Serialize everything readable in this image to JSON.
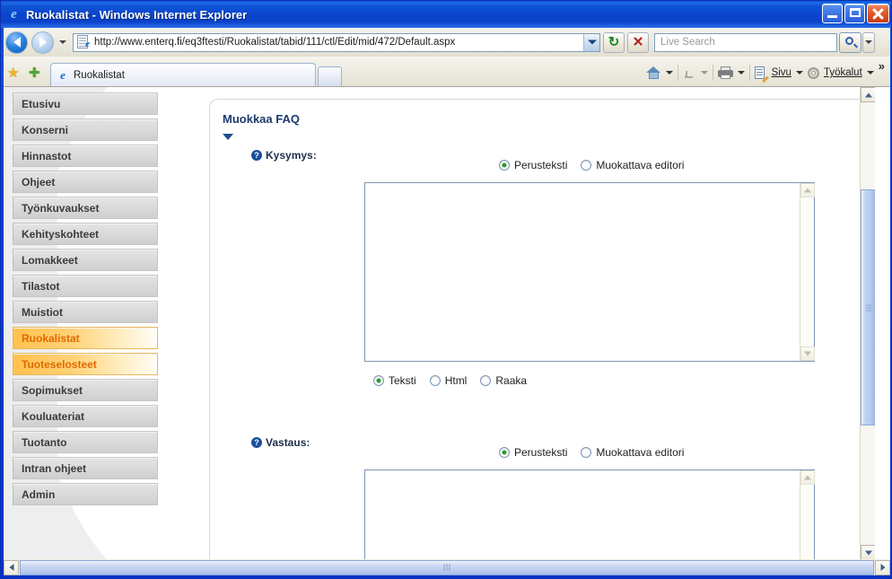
{
  "window": {
    "title": "Ruokalistat - Windows Internet Explorer",
    "app_icon": "internet-explorer-icon",
    "minimize_label": "Minimize",
    "maximize_label": "Maximize",
    "close_label": "Close"
  },
  "navbar": {
    "back_label": "Back",
    "forward_label": "Forward",
    "history_label": "Recent Pages",
    "address_value": "http://www.enterq.fi/eq3ftesti/Ruokalistat/tabid/111/ctl/Edit/mid/472/Default.aspx",
    "address_icon": "page-icon",
    "refresh_glyph": "↻",
    "stop_glyph": "✕",
    "search_placeholder": "Live Search",
    "search_value": "",
    "search_button_icon": "magnifier-icon"
  },
  "tabbar": {
    "favorites_icon": "star-icon",
    "add_favorite_icon": "add-star-icon",
    "tabs": [
      {
        "label": "Ruokalistat",
        "icon": "internet-explorer-icon",
        "active": true
      }
    ],
    "new_tab_label": "",
    "commands": [
      {
        "label": "",
        "icon": "home-icon",
        "has_caret": true
      },
      {
        "label": "",
        "icon": "feed-icon",
        "has_caret": true
      },
      {
        "label": "",
        "icon": "print-icon",
        "has_caret": true
      },
      {
        "label": "Sivu",
        "icon": "page-icon",
        "has_caret": true
      },
      {
        "label": "Työkalut",
        "icon": "gear-icon",
        "has_caret": true
      }
    ],
    "overflow_glyph": "»"
  },
  "sidebar": {
    "items": [
      {
        "label": "Etusivu",
        "active": false
      },
      {
        "label": "Konserni",
        "active": false
      },
      {
        "label": "Hinnastot",
        "active": false
      },
      {
        "label": "Ohjeet",
        "active": false
      },
      {
        "label": "Työnkuvaukset",
        "active": false
      },
      {
        "label": "Kehityskohteet",
        "active": false
      },
      {
        "label": "Lomakkeet",
        "active": false
      },
      {
        "label": "Tilastot",
        "active": false
      },
      {
        "label": "Muistiot",
        "active": false
      },
      {
        "label": "Ruokalistat",
        "active": true
      },
      {
        "label": "Tuoteselosteet",
        "active": true
      },
      {
        "label": "Sopimukset",
        "active": false
      },
      {
        "label": "Kouluateriat",
        "active": false
      },
      {
        "label": "Tuotanto",
        "active": false
      },
      {
        "label": "Intran ohjeet",
        "active": false
      },
      {
        "label": "Admin",
        "active": false
      }
    ]
  },
  "main": {
    "panel_title": "Muokkaa FAQ",
    "collapse_icon": "triangle-down-icon",
    "help_glyph": "?",
    "fields": [
      {
        "label": "Kysymys:",
        "help_icon": "help-icon",
        "editor_modes": [
          {
            "label": "Perusteksti",
            "selected": true
          },
          {
            "label": "Muokattava editori",
            "selected": false
          }
        ],
        "value": "",
        "format_modes": [
          {
            "label": "Teksti",
            "selected": true
          },
          {
            "label": "Html",
            "selected": false
          },
          {
            "label": "Raaka",
            "selected": false
          }
        ]
      },
      {
        "label": "Vastaus:",
        "help_icon": "help-icon",
        "editor_modes": [
          {
            "label": "Perusteksti",
            "selected": true
          },
          {
            "label": "Muokattava editori",
            "selected": false
          }
        ],
        "value": "",
        "format_modes": []
      }
    ]
  },
  "scrollbars": {
    "vertical_up": "▲",
    "vertical_down": "▼",
    "horizontal_left": "◄",
    "horizontal_right": "►"
  },
  "colors": {
    "titlebar": "#0a45cd",
    "accent_active": "#e06a00",
    "active_menu_bg": "#ffc14d",
    "panel_title": "#1a3b6e",
    "radio_dot": "#1f9e2a"
  }
}
